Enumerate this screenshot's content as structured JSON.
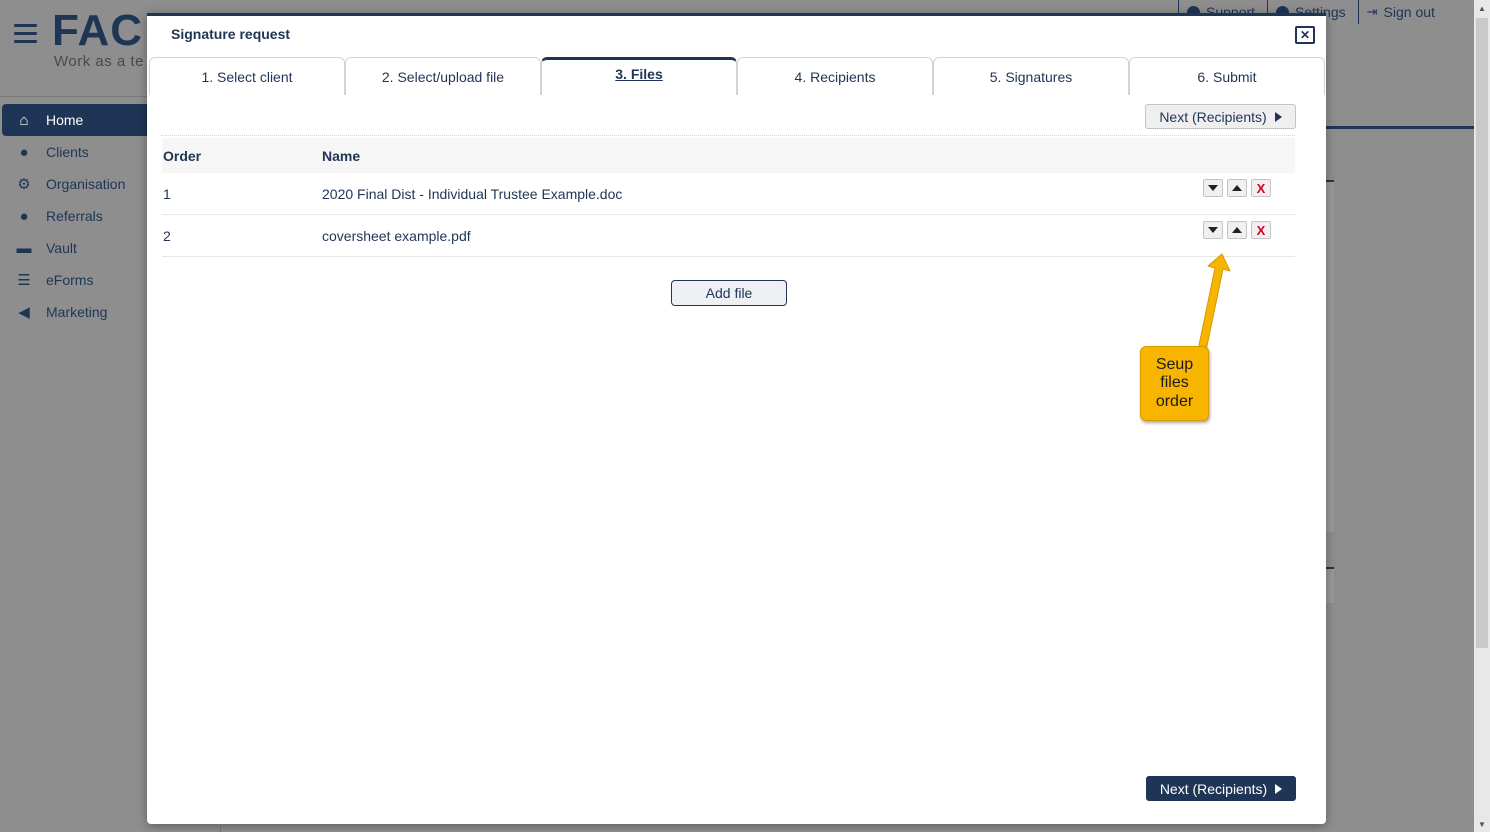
{
  "app": {
    "logo_text": "FAC",
    "logo_tagline": "Work as a te",
    "top_links": [
      {
        "label": "Support",
        "icon": "help-icon"
      },
      {
        "label": "Settings",
        "icon": "gear-icon"
      },
      {
        "label": "Sign out",
        "icon": "sign-out-icon"
      }
    ],
    "sidebar": {
      "items": [
        {
          "label": "Home",
          "icon": "home-icon",
          "active": true
        },
        {
          "label": "Clients",
          "icon": "users-icon"
        },
        {
          "label": "Organisation",
          "icon": "organisation-icon"
        },
        {
          "label": "Referrals",
          "icon": "referrals-icon"
        },
        {
          "label": "Vault",
          "icon": "archive-icon"
        },
        {
          "label": "eForms",
          "icon": "list-icon"
        },
        {
          "label": "Marketing",
          "icon": "megaphone-icon"
        }
      ]
    }
  },
  "modal": {
    "title": "Signature request",
    "close_label": "✕",
    "tabs": [
      {
        "label": "1. Select client",
        "active": false
      },
      {
        "label": "2. Select/upload file",
        "active": false
      },
      {
        "label": "3. Files",
        "active": true
      },
      {
        "label": "4. Recipients",
        "active": false
      },
      {
        "label": "5. Signatures",
        "active": false
      },
      {
        "label": "6. Submit",
        "active": false
      }
    ],
    "next_button_label": "Next (Recipients)",
    "table": {
      "headers": {
        "order": "Order",
        "name": "Name"
      },
      "rows": [
        {
          "order": "1",
          "name": "2020 Final Dist - Individual Trustee Example.doc"
        },
        {
          "order": "2",
          "name": "coversheet example.pdf"
        }
      ],
      "delete_label": "X"
    },
    "add_file_label": "Add file"
  },
  "annotation": {
    "text": "Seup files order",
    "color": "#f7b500"
  },
  "colors": {
    "primary": "#1f3556",
    "delete": "#d0021b",
    "overlay": "#8e8e8e"
  }
}
